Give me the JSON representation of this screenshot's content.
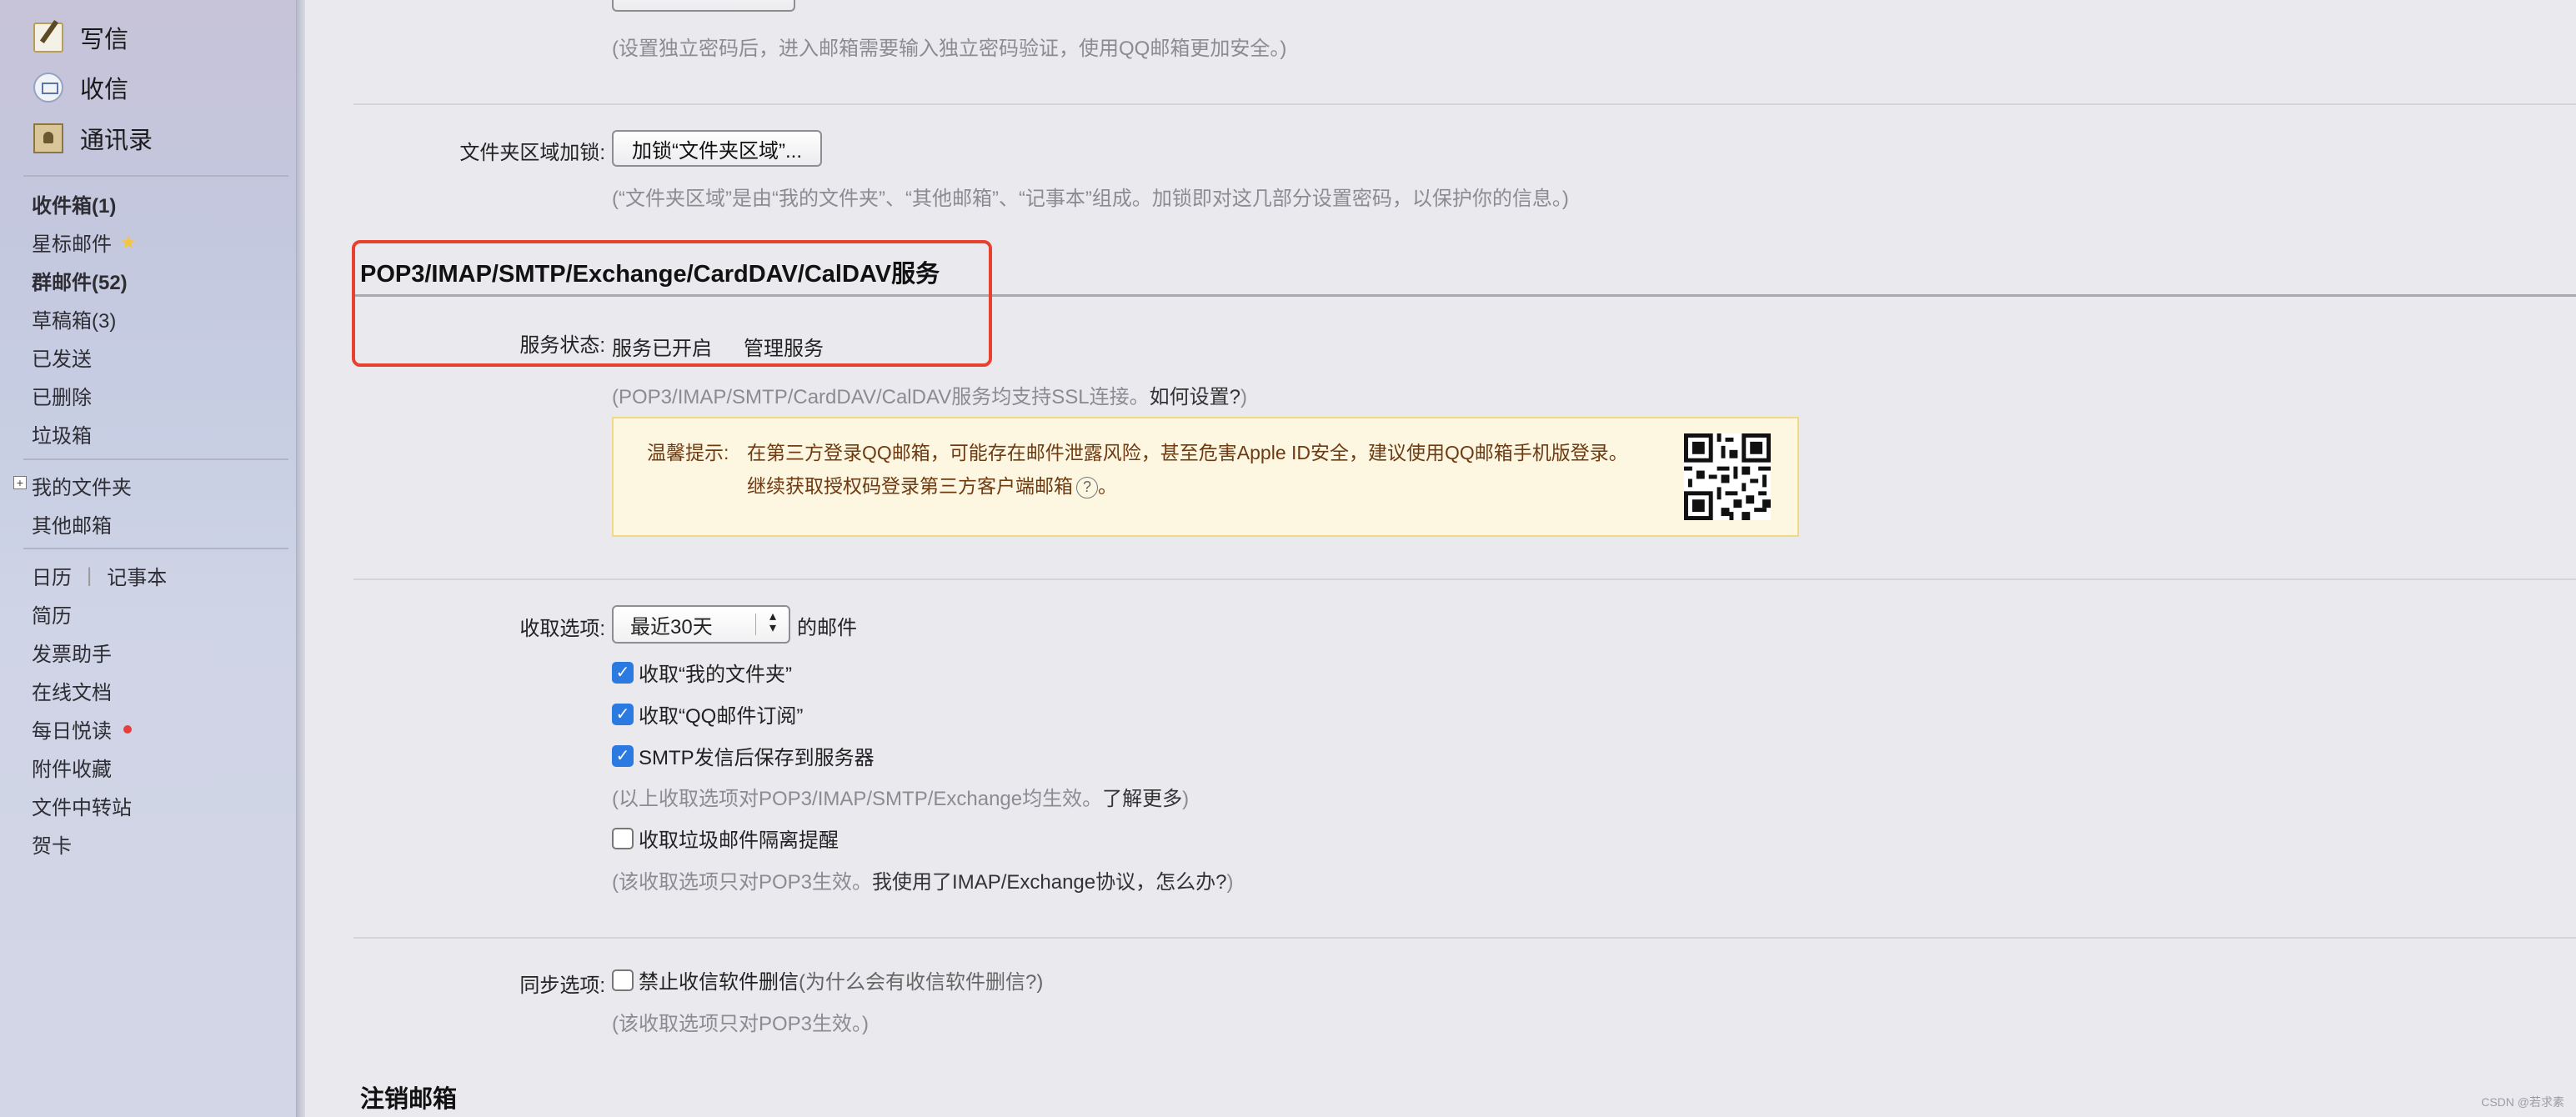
{
  "sidebar": {
    "actions": [
      {
        "label": "写信",
        "icon": "compose-icon"
      },
      {
        "label": "收信",
        "icon": "inbox-icon"
      },
      {
        "label": "通讯录",
        "icon": "contacts-icon"
      }
    ],
    "folders": [
      {
        "label": "收件箱(1)",
        "bold": true
      },
      {
        "label": "星标邮件",
        "bold": false
      },
      {
        "label": "群邮件(52)",
        "bold": true
      },
      {
        "label": "草稿箱(3)",
        "bold": false
      },
      {
        "label": "已发送",
        "bold": false
      },
      {
        "label": "已删除",
        "bold": false
      },
      {
        "label": "垃圾箱",
        "bold": false
      }
    ],
    "my_folders": "我的文件夹",
    "other_mailbox": "其他邮箱",
    "calendar": "日历",
    "notes": "记事本",
    "tools": [
      "简历",
      "发票助手",
      "在线文档",
      "每日悦读",
      "附件收藏",
      "文件中转站",
      "贺卡"
    ]
  },
  "main": {
    "password_note": "(设置独立密码后，进入邮箱需要输入独立密码验证，使用QQ邮箱更加安全。)",
    "folder_lock_label": "文件夹区域加锁:",
    "folder_lock_button": "加锁“文件夹区域”...",
    "folder_lock_note": "(“文件夹区域”是由“我的文件夹”、“其他邮箱”、“记事本”组成。加锁即对这几部分设置密码，以保护你的信息。)",
    "service_title": "POP3/IMAP/SMTP/Exchange/CardDAV/CalDAV服务",
    "service_status_label": "服务状态:",
    "service_status_value": "服务已开启",
    "manage_service": "管理服务",
    "ssl_note": "(POP3/IMAP/SMTP/CardDAV/CalDAV服务均支持SSL连接。",
    "ssl_help": "如何设置?",
    "ssl_note_end": ")",
    "tip_label": "温馨提示:",
    "tip_line1": "在第三方登录QQ邮箱，可能存在邮件泄露风险，甚至危害Apple ID安全，建议使用QQ邮箱手机版登录。",
    "tip_line2_prefix": "继续获取授权码",
    "tip_line2_link": "登录第三方客户端邮箱",
    "tip_line2_end": "。",
    "receive_label": "收取选项:",
    "receive_range": "最近30天",
    "receive_suffix": "的邮件",
    "opt_my_folders": "收取“我的文件夹”",
    "opt_subscriptions": "收取“QQ邮件订阅”",
    "opt_smtp_save": "SMTP发信后保存到服务器",
    "opt_note_prefix": "(以上收取选项对POP3/IMAP/SMTP/Exchange均生效。",
    "opt_note_link": "了解更多",
    "opt_note_end": ")",
    "opt_spam": "收取垃圾邮件隔离提醒",
    "spam_note_prefix": "(该收取选项只对POP3生效。",
    "spam_note_link": "我使用了IMAP/Exchange协议，怎么办?",
    "spam_note_end": ")",
    "sync_label": "同步选项:",
    "sync_option": "禁止收信软件删信",
    "sync_help": "(为什么会有收信软件删信?)",
    "sync_note": "(该收取选项只对POP3生效。)",
    "cancel_title": "注销邮箱"
  },
  "checkbox_states": {
    "my_folders": true,
    "subscriptions": true,
    "smtp_save": true,
    "spam": false,
    "sync_delete": false
  },
  "watermark": "CSDN @若求素",
  "colors": {
    "highlight": "#e8412f",
    "tip_bg": "#fdf7e1",
    "checkbox": "#2a7ae2"
  }
}
